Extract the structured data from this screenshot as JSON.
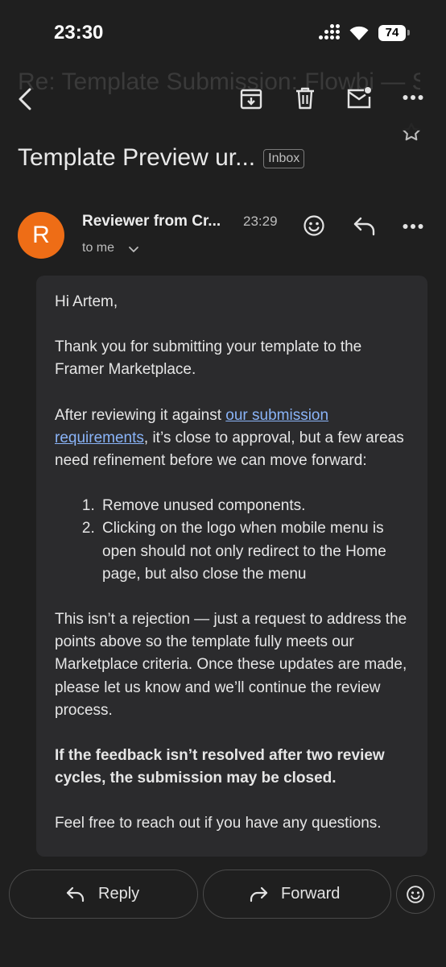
{
  "status_bar": {
    "time": "23:30",
    "battery": "74"
  },
  "thread": {
    "ghost_subject": "Re: Template Submission: Flowbi — SaaS Landing Page",
    "subject": "Template Preview ur...",
    "label": "Inbox"
  },
  "message": {
    "avatar_letter": "R",
    "sender": "Reviewer from Cr...",
    "time": "23:29",
    "to": "to me",
    "greeting": "Hi Artem,",
    "para1": "Thank you for submitting your template to the Framer Marketplace.",
    "para2_before": "After reviewing it against ",
    "para2_link": "our submission requirements",
    "para2_after": ", it’s close to approval, but a few areas need refinement before we can move forward:",
    "list": [
      "Remove unused components.",
      "Clicking on the logo when mobile menu is open should not only redirect to the Home page, but also close the menu"
    ],
    "para3": "This isn’t a rejection — just a request to address the points above so the template fully meets our Marketplace criteria. Once these updates are made, please let us know and we’ll continue the review process.",
    "para4": "If the feedback isn’t resolved after two review cycles, the submission may be closed.",
    "para5": "Feel free to reach out if you have any questions."
  },
  "actions": {
    "reply": "Reply",
    "forward": "Forward"
  },
  "icons": [
    "back-icon",
    "archive-icon",
    "delete-icon",
    "mark-unread-icon",
    "more-icon",
    "star-icon",
    "emoji-icon",
    "reply-icon",
    "forward-icon",
    "chevron-down-icon"
  ],
  "colors": {
    "background": "#1f1f1f",
    "card": "#2b2b2d",
    "avatar": "#ee6d16",
    "link": "#8ab4f8"
  }
}
